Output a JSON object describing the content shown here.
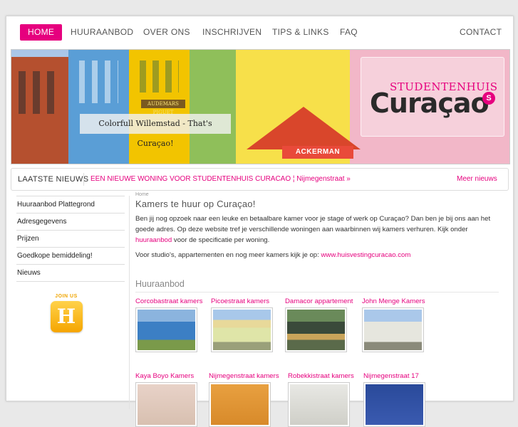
{
  "nav": {
    "items": [
      "HOME",
      "HUURAANBOD",
      "OVER ONS",
      "INSCHRIJVEN",
      "TIPS & LINKS",
      "FAQ"
    ],
    "contact": "CONTACT"
  },
  "hero": {
    "caption": "Colorfull Willemstad - That's Curaçao!",
    "logo_top": "STUDENTENHUIS",
    "logo_main": "Curaçao",
    "logo_badge": "S",
    "sign_audemars": "AUDEMARS PIGUET",
    "sign_ackerman": "ACKERMAN"
  },
  "news": {
    "label": "LAATSTE NIEUWS",
    "item": "EEN NIEUWE WONING VOOR STUDENTENHUIS CURACAO ¦ Nijmegenstraat »",
    "more": "Meer nieuws"
  },
  "sidebar": {
    "items": [
      "Huuraanbod Plattegrond",
      "Adresgegevens",
      "Prijzen",
      "Goedkope bemiddeling!",
      "Nieuws"
    ],
    "join_text": "JOIN US",
    "join_letter": "H"
  },
  "main": {
    "breadcrumb": "Home",
    "title": "Kamers te huur op Curaçao!",
    "para1_a": "Ben jij nog opzoek naar een leuke en betaalbare kamer voor je stage of werk op Curaçao? Dan ben je bij ons aan het goede adres. Op deze website tref je verschillende woningen aan waarbinnen wij kamers verhuren. Kijk onder",
    "para1_link": "huuraanbod",
    "para1_b": "voor de specificatie per woning.",
    "para2_a": "Voor studio's, appartementen en nog meer kamers kijk je op:",
    "para2_link": "www.huisvestingcuracao.com",
    "section_title": "Huuraanbod",
    "offers": [
      "Corcobastraat kamers",
      "Picoestraat kamers",
      "Damacor appartement",
      "John Menge Kamers",
      "Kaya Boyo Kamers",
      "Nijmegenstraat kamers",
      "Robekkistraat kamers",
      "Nijmegenstraat 17"
    ]
  },
  "colors": {
    "accent": "#e6007e",
    "join": "#f5a500"
  }
}
